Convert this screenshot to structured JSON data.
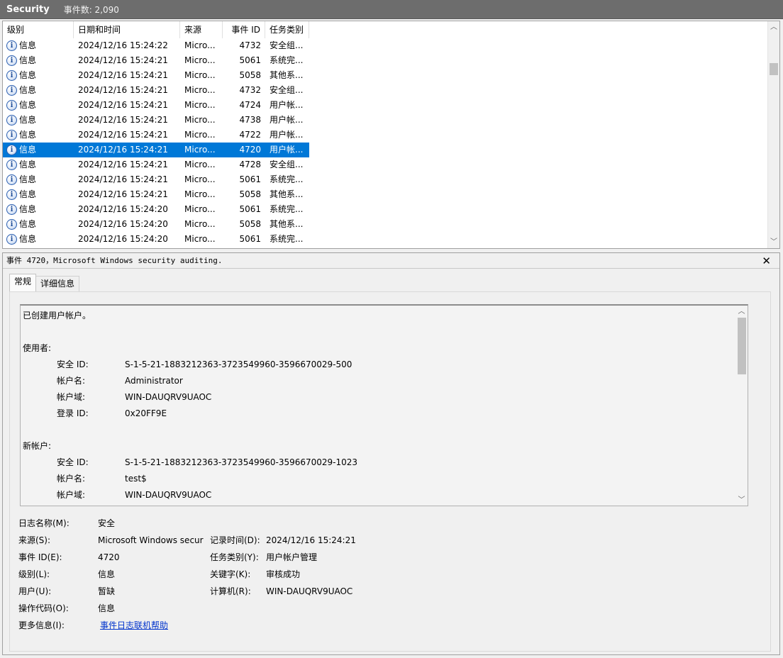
{
  "titlebar": {
    "name": "Security",
    "count": "事件数: 2,090"
  },
  "list": {
    "columns": [
      "级别",
      "日期和时间",
      "来源",
      "事件 ID",
      "任务类别"
    ],
    "rows": [
      [
        "信息",
        "2024/12/16 15:24:22",
        "Micro...",
        "4732",
        "安全组..."
      ],
      [
        "信息",
        "2024/12/16 15:24:21",
        "Micro...",
        "5061",
        "系统完..."
      ],
      [
        "信息",
        "2024/12/16 15:24:21",
        "Micro...",
        "5058",
        "其他系..."
      ],
      [
        "信息",
        "2024/12/16 15:24:21",
        "Micro...",
        "4732",
        "安全组..."
      ],
      [
        "信息",
        "2024/12/16 15:24:21",
        "Micro...",
        "4724",
        "用户帐..."
      ],
      [
        "信息",
        "2024/12/16 15:24:21",
        "Micro...",
        "4738",
        "用户帐..."
      ],
      [
        "信息",
        "2024/12/16 15:24:21",
        "Micro...",
        "4722",
        "用户帐..."
      ],
      [
        "信息",
        "2024/12/16 15:24:21",
        "Micro...",
        "4720",
        "用户帐..."
      ],
      [
        "信息",
        "2024/12/16 15:24:21",
        "Micro...",
        "4728",
        "安全组..."
      ],
      [
        "信息",
        "2024/12/16 15:24:21",
        "Micro...",
        "5061",
        "系统完..."
      ],
      [
        "信息",
        "2024/12/16 15:24:21",
        "Micro...",
        "5058",
        "其他系..."
      ],
      [
        "信息",
        "2024/12/16 15:24:20",
        "Micro...",
        "5061",
        "系统完..."
      ],
      [
        "信息",
        "2024/12/16 15:24:20",
        "Micro...",
        "5058",
        "其他系..."
      ],
      [
        "信息",
        "2024/12/16 15:24:20",
        "Micro...",
        "5061",
        "系统完..."
      ]
    ],
    "selected_row": 7
  },
  "detail": {
    "header": "事件 4720，Microsoft Windows security auditing.",
    "tabs": [
      "常规",
      "详细信息"
    ],
    "description": {
      "line1": "已创建用户帐户。",
      "subject_heading": "使用者:",
      "subject": [
        [
          "安全 ID:",
          "S-1-5-21-1883212363-3723549960-3596670029-500"
        ],
        [
          "帐户名:",
          "Administrator"
        ],
        [
          "帐户域:",
          "WIN-DAUQRV9UAOC"
        ],
        [
          "登录 ID:",
          "0x20FF9E"
        ]
      ],
      "new_heading": "新帐户:",
      "new_account": [
        [
          "安全 ID:",
          "S-1-5-21-1883212363-3723549960-3596670029-1023"
        ],
        [
          "帐户名:",
          "test$"
        ],
        [
          "帐户域:",
          "WIN-DAUQRV9UAOC"
        ]
      ]
    },
    "props": {
      "log_name_label": "日志名称(M):",
      "log_name": "安全",
      "source_label": "来源(S):",
      "source": "Microsoft Windows secur",
      "logged_label": "记录时间(D):",
      "logged": "2024/12/16 15:24:21",
      "event_id_label": "事件 ID(E):",
      "event_id": "4720",
      "task_label": "任务类别(Y):",
      "task": "用户帐户管理",
      "level_label": "级别(L):",
      "level": "信息",
      "keywords_label": "关键字(K):",
      "keywords": "审核成功",
      "user_label": "用户(U):",
      "user": "暂缺",
      "computer_label": "计算机(R):",
      "computer": "WIN-DAUQRV9UAOC",
      "opcode_label": "操作代码(O):",
      "opcode": "信息",
      "more_label": "更多信息(I):",
      "more_link": "事件日志联机帮助"
    }
  }
}
